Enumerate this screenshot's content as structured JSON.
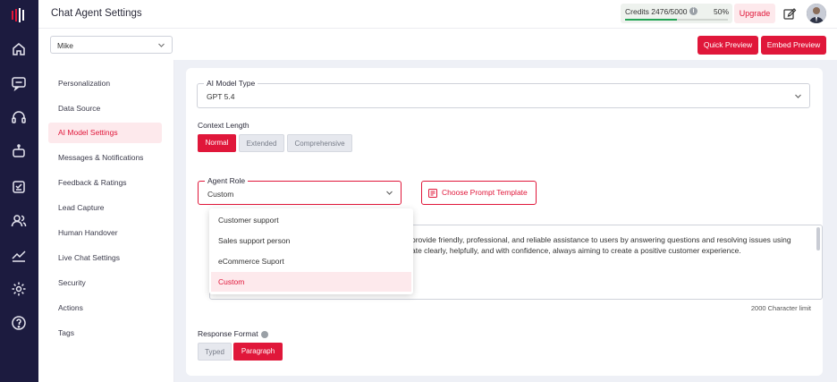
{
  "header": {
    "title": "Chat Agent Settings"
  },
  "credits": {
    "label": "Credits 2476/5000",
    "percent_label": "50%",
    "used_fraction": 0.5,
    "bar_color": "#23a455"
  },
  "upgrade_label": "Upgrade",
  "agent_select": {
    "value": "Mike"
  },
  "actions": {
    "quick_preview": "Quick Preview",
    "embed_preview": "Embed Preview"
  },
  "rail_icons": [
    "home-icon",
    "chat-icon",
    "headset-icon",
    "bot-icon",
    "inbox-icon",
    "users-icon",
    "analytics-icon",
    "settings-icon",
    "help-icon"
  ],
  "sidebar": {
    "items": [
      {
        "label": "Personalization",
        "active": false
      },
      {
        "label": "Data Source",
        "active": false
      },
      {
        "label": "AI Model Settings",
        "active": true
      },
      {
        "label": "Messages & Notifications",
        "active": false
      },
      {
        "label": "Feedback & Ratings",
        "active": false
      },
      {
        "label": "Lead Capture",
        "active": false
      },
      {
        "label": "Human Handover",
        "active": false
      },
      {
        "label": "Live Chat Settings",
        "active": false
      },
      {
        "label": "Security",
        "active": false
      },
      {
        "label": "Actions",
        "active": false
      },
      {
        "label": "Tags",
        "active": false
      }
    ]
  },
  "model": {
    "label": "AI Model Type",
    "value": "GPT 5.4"
  },
  "context": {
    "label": "Context Length",
    "options": [
      "Normal",
      "Extended",
      "Comprehensive"
    ],
    "selected": "Normal"
  },
  "agent_role": {
    "label": "Agent Role",
    "value": "Custom",
    "options": [
      "Customer support",
      "Sales support person",
      "eCommerce Suport",
      "Custom"
    ],
    "selected": "Custom"
  },
  "prompt_template_label": "Choose Prompt Template",
  "prompt": {
    "line1": "provide friendly, professional, and reliable assistance to users by answering questions and resolving issues using",
    "line2": "ate clearly, helpfully, and with confidence, always aiming to create a positive customer experience.",
    "limit": "2000 Character limit"
  },
  "response_format": {
    "label": "Response Format",
    "options": [
      "Typed",
      "Paragraph"
    ],
    "selected": "Paragraph"
  },
  "colors": {
    "accent": "#e0173a",
    "rail": "#1c1b3f",
    "content_bg": "#eef0f6"
  }
}
